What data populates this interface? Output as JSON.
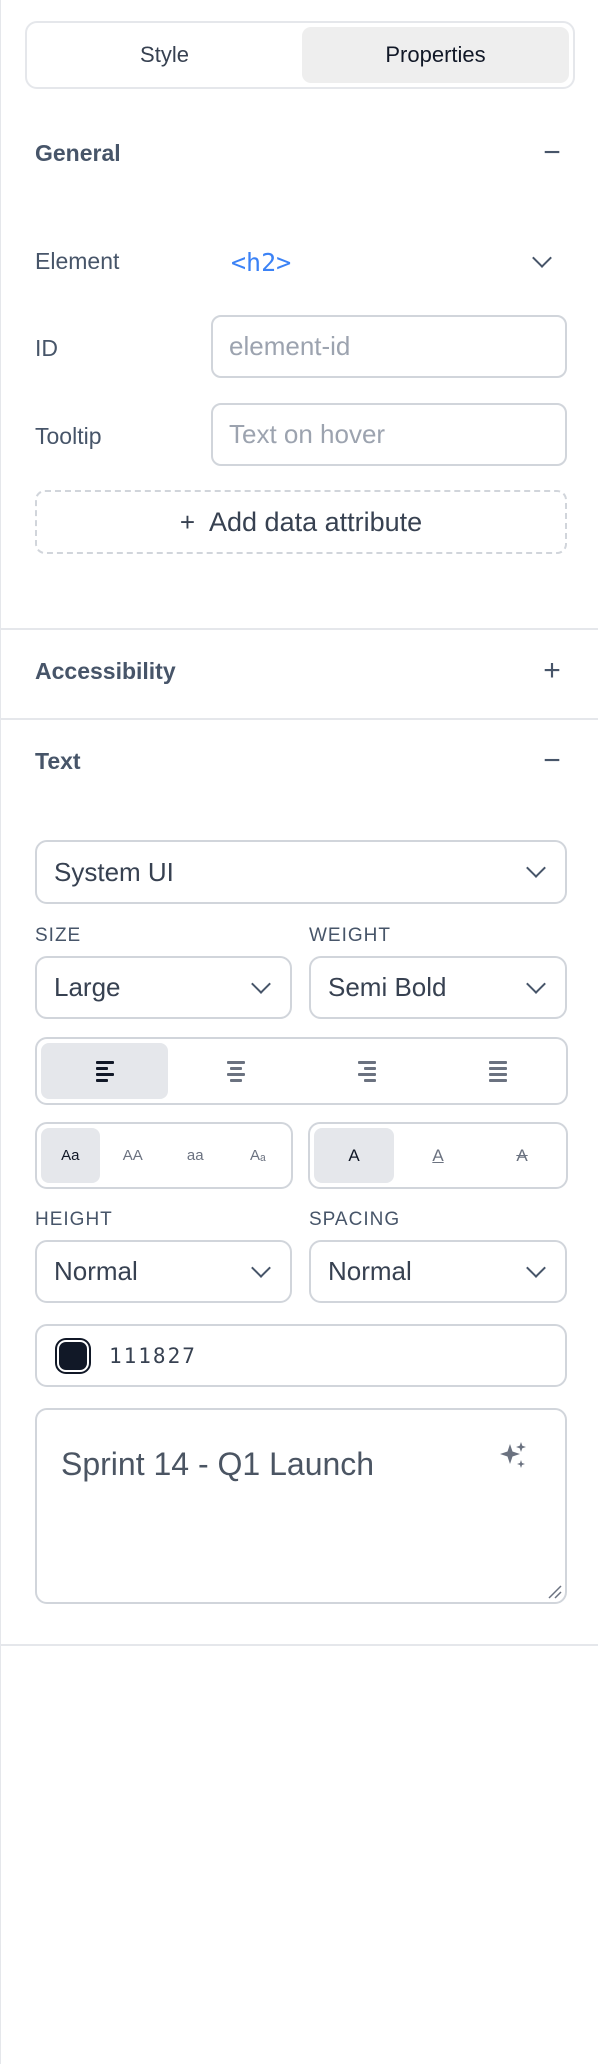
{
  "tabs": [
    {
      "label": "Style",
      "active": false
    },
    {
      "label": "Properties",
      "active": true
    }
  ],
  "general": {
    "title": "General",
    "toggle": "−",
    "element_label": "Element",
    "element_value": "<h2>",
    "id_label": "ID",
    "id_placeholder": "element-id",
    "tooltip_label": "Tooltip",
    "tooltip_placeholder": "Text on hover",
    "add_attribute_plus": "+",
    "add_attribute_label": "Add data attribute"
  },
  "accessibility": {
    "title": "Accessibility",
    "toggle": "+"
  },
  "text": {
    "title": "Text",
    "toggle": "−",
    "font_family": "System UI",
    "size_label": "SIZE",
    "size_value": "Large",
    "weight_label": "WEIGHT",
    "weight_value": "Semi Bold",
    "alignment": {
      "options": [
        "left",
        "center",
        "right",
        "justify"
      ],
      "selected": "left"
    },
    "case_options": [
      "Aa",
      "AA",
      "aa",
      "Aₐ"
    ],
    "case_selected": "Aa",
    "decoration_options": [
      "A",
      "A",
      "A"
    ],
    "decoration_names": [
      "none",
      "underline",
      "strikethrough"
    ],
    "decoration_selected": "none",
    "height_label": "HEIGHT",
    "height_value": "Normal",
    "spacing_label": "SPACING",
    "spacing_value": "Normal",
    "color_hex": "111827",
    "color_swatch": "#111827",
    "content": "Sprint 14 - Q1 Launch"
  },
  "colors": {
    "accent": "#3b82f6",
    "border": "#d1d5db",
    "active_segment": "#e5e7eb"
  }
}
